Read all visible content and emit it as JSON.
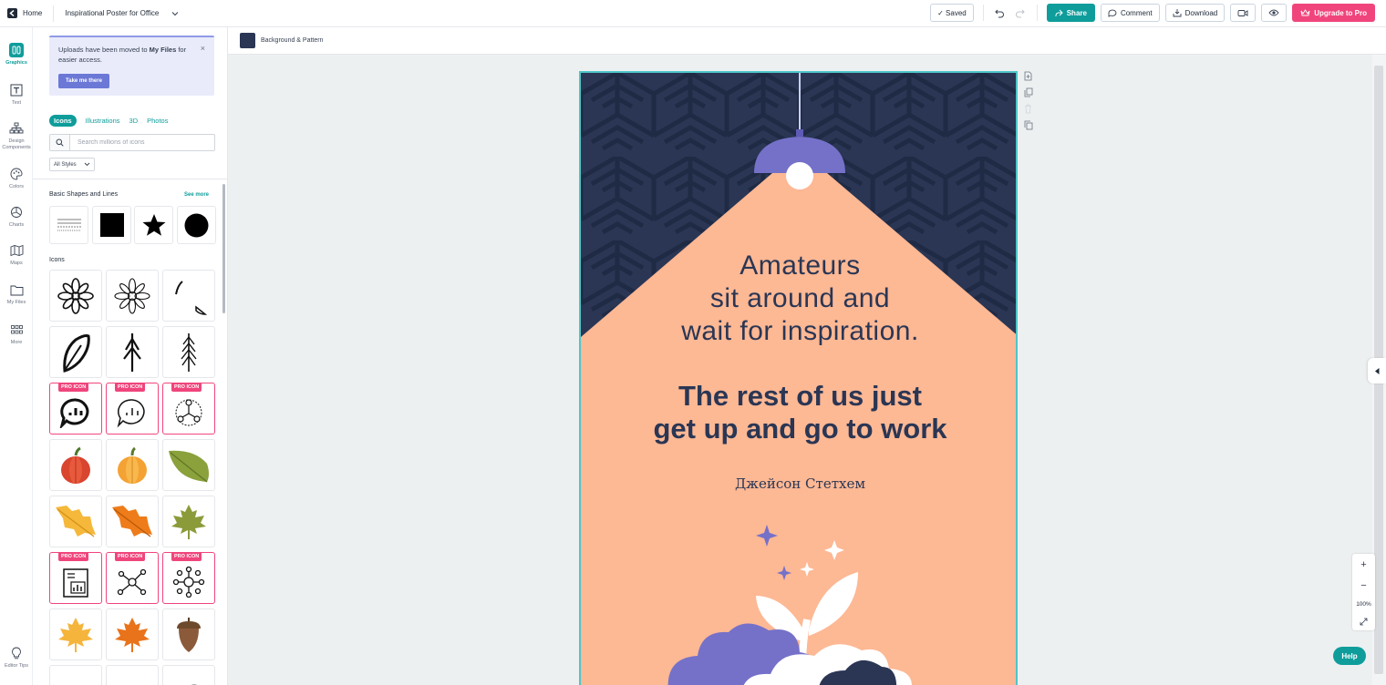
{
  "topbar": {
    "home_label": "Home",
    "doc_title": "Inspirational Poster for Office",
    "saved_label": "✓ Saved",
    "share_label": "Share",
    "comment_label": "Comment",
    "download_label": "Download",
    "upgrade_label": "Upgrade to Pro"
  },
  "rail": {
    "items": [
      {
        "label": "Graphics",
        "icon": "graphics-icon"
      },
      {
        "label": "Text",
        "icon": "text-icon"
      },
      {
        "label": "Design Components",
        "icon": "components-icon"
      },
      {
        "label": "Colors",
        "icon": "palette-icon"
      },
      {
        "label": "Charts",
        "icon": "chart-icon"
      },
      {
        "label": "Maps",
        "icon": "map-icon"
      },
      {
        "label": "My Files",
        "icon": "folder-icon"
      },
      {
        "label": "More",
        "icon": "grid-icon"
      },
      {
        "label": "Editor Tips",
        "icon": "lightbulb-icon"
      }
    ]
  },
  "panel": {
    "notice_pre": "Uploads have been moved to ",
    "notice_bold": "My Files",
    "notice_post": " for easier access.",
    "notice_button": "Take me there",
    "tabs": [
      "Icons",
      "Illustrations",
      "3D",
      "Photos"
    ],
    "search_placeholder": "Search millions of icons",
    "styles_label": "All Styles",
    "shapes_heading": "Basic Shapes and Lines",
    "see_more": "See more",
    "icons_heading": "Icons",
    "pro_badge": "PRO ICON"
  },
  "subbar": {
    "label": "Background & Pattern",
    "swatch_color": "#2a3654"
  },
  "poster": {
    "line1": "Amateurs",
    "line2": "sit around and",
    "line3": "wait for inspiration.",
    "line4": "The rest of us just",
    "line5": "get up and go to work",
    "author": "Джейсон Стетхем",
    "colors": {
      "navy": "#2a3654",
      "peach": "#fdb894",
      "purple": "#7571c9"
    }
  },
  "zoom": {
    "plus": "+",
    "minus": "−",
    "level": "100%"
  },
  "help_label": "Help"
}
